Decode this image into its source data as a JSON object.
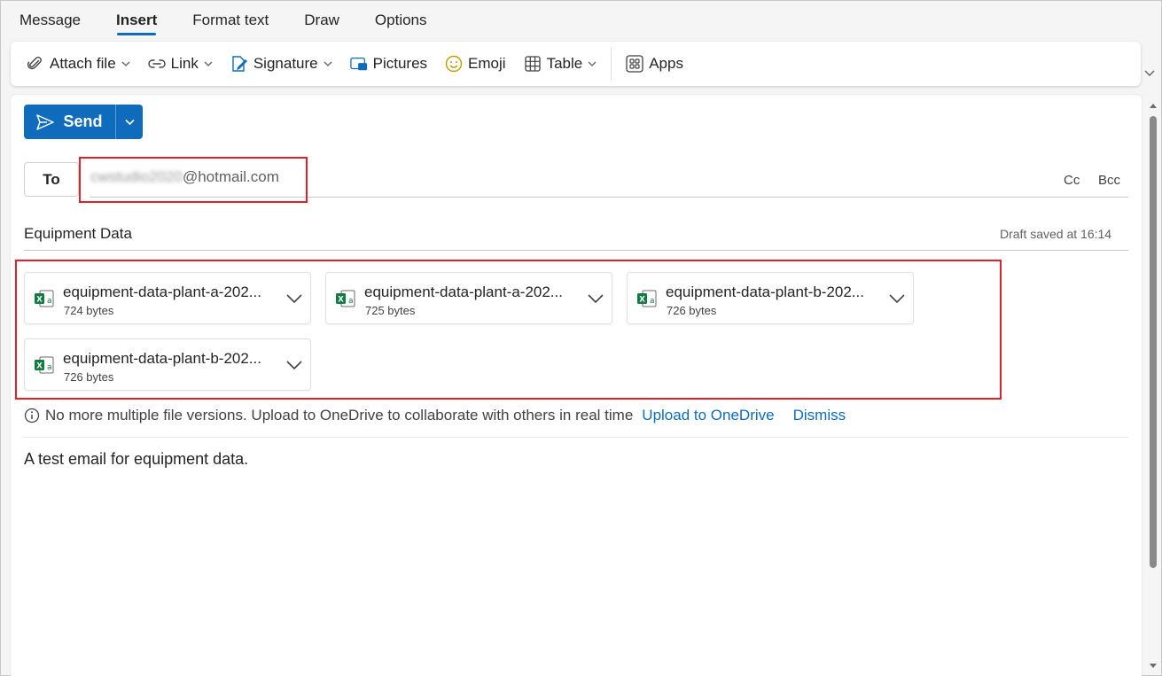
{
  "tabs": [
    {
      "label": "Message"
    },
    {
      "label": "Insert"
    },
    {
      "label": "Format text"
    },
    {
      "label": "Draw"
    },
    {
      "label": "Options"
    }
  ],
  "active_tab": "Insert",
  "ribbon": {
    "attach_file": "Attach file",
    "link": "Link",
    "signature": "Signature",
    "pictures": "Pictures",
    "emoji": "Emoji",
    "table": "Table",
    "apps": "Apps"
  },
  "compose": {
    "send_label": "Send",
    "to_label": "To",
    "recipient_blurred": "cwstudio2020",
    "recipient_domain": "@hotmail.com",
    "cc_label": "Cc",
    "bcc_label": "Bcc",
    "subject": "Equipment Data",
    "draft_status": "Draft saved at 16:14",
    "attachments": [
      {
        "name": "equipment-data-plant-a-202...",
        "size": "724 bytes"
      },
      {
        "name": "equipment-data-plant-a-202...",
        "size": "725 bytes"
      },
      {
        "name": "equipment-data-plant-b-202...",
        "size": "726 bytes"
      },
      {
        "name": "equipment-data-plant-b-202...",
        "size": "726 bytes"
      }
    ],
    "info_message": "No more multiple file versions. Upload to OneDrive to collaborate with others in real time",
    "upload_link": "Upload to OneDrive",
    "dismiss_link": "Dismiss",
    "body": "A test email for equipment data."
  },
  "colors": {
    "accent": "#0f6cbd",
    "highlight": "#e0202d",
    "excel_green": "#107c41"
  }
}
